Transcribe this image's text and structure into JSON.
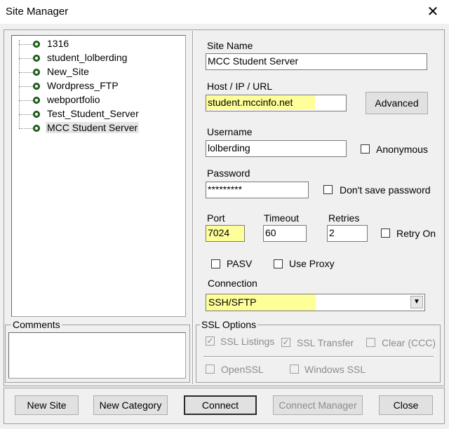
{
  "window": {
    "title": "Site Manager"
  },
  "tree": {
    "items": [
      {
        "label": "1316"
      },
      {
        "label": "student_lolberding"
      },
      {
        "label": "New_Site"
      },
      {
        "label": "Wordpress_FTP"
      },
      {
        "label": "webportfolio"
      },
      {
        "label": "Test_Student_Server"
      },
      {
        "label": "MCC Student Server",
        "selected": true
      }
    ]
  },
  "form": {
    "site_name_label": "Site Name",
    "site_name_value": "MCC Student Server",
    "host_label": "Host / IP / URL",
    "host_value": "student.mccinfo.net",
    "advanced_label": "Advanced",
    "username_label": "Username",
    "username_value": "lolberding",
    "anonymous_label": "Anonymous",
    "password_label": "Password",
    "password_value": "*********",
    "dont_save_label": "Don't save password",
    "port_label": "Port",
    "port_value": "7024",
    "timeout_label": "Timeout",
    "timeout_value": "60",
    "retries_label": "Retries",
    "retries_value": "2",
    "retry_on_label": "Retry On",
    "pasv_label": "PASV",
    "use_proxy_label": "Use Proxy",
    "connection_label": "Connection",
    "connection_value": "SSH/SFTP"
  },
  "comments": {
    "label": "Comments",
    "value": ""
  },
  "ssl": {
    "label": "SSL Options",
    "ssl_listings": "SSL Listings",
    "ssl_transfer": "SSL Transfer",
    "clear_ccc": "Clear (CCC)",
    "openssl": "OpenSSL",
    "windows_ssl": "Windows SSL"
  },
  "buttons": {
    "new_site": "New Site",
    "new_category": "New Category",
    "connect": "Connect",
    "connect_manager": "Connect Manager",
    "close": "Close"
  },
  "colors": {
    "highlight": "#ffff99",
    "window_bg": "#f0f0f0"
  },
  "icons": {
    "close": "close-icon",
    "tree_node": "site-node-icon",
    "dropdown": "chevron-down-icon"
  }
}
